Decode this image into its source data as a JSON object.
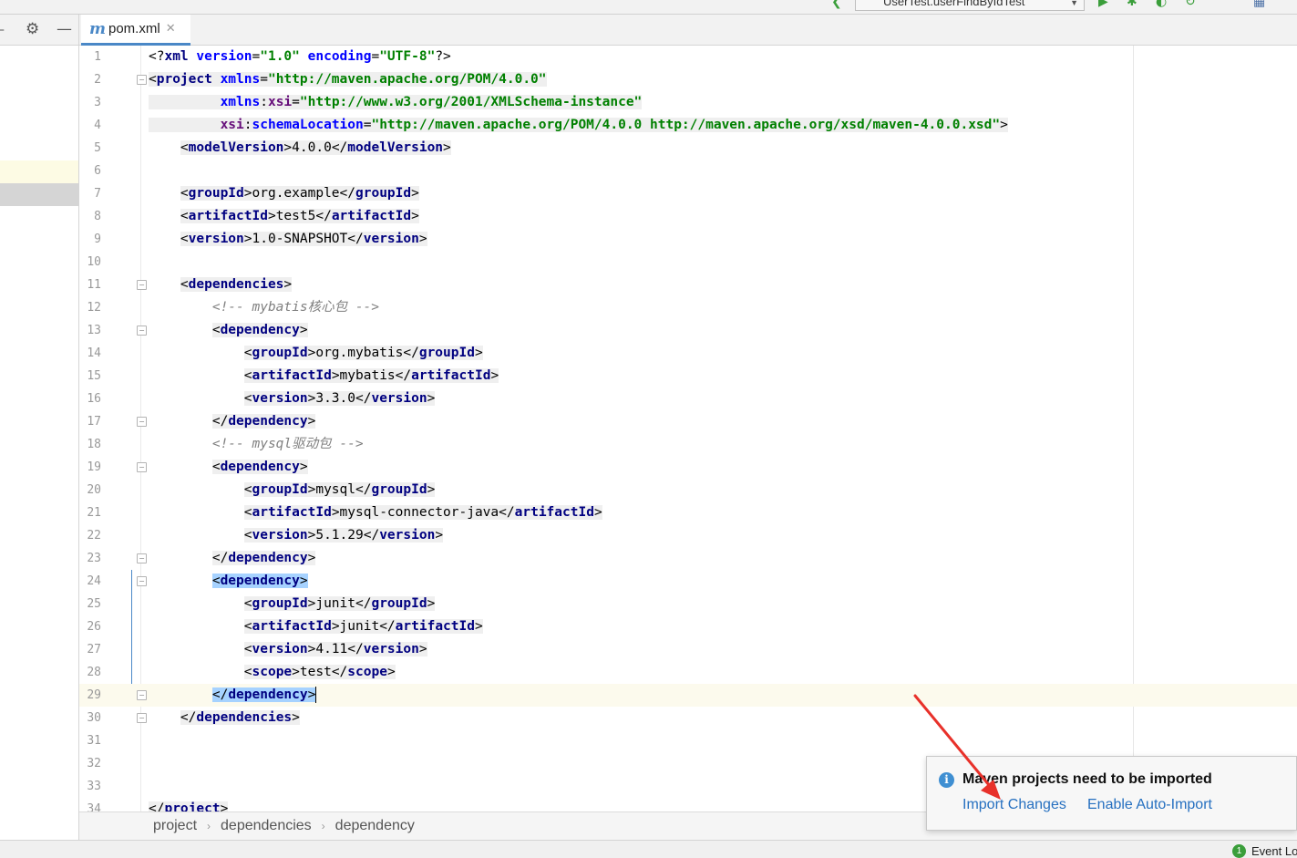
{
  "toolbar": {
    "run_config": "UserTest.userFindByIdTest"
  },
  "tab": {
    "label": "pom.xml",
    "icon": "m"
  },
  "editor": {
    "line_numbers": [
      "1",
      "2",
      "3",
      "4",
      "5",
      "6",
      "7",
      "8",
      "9",
      "10",
      "11",
      "12",
      "13",
      "14",
      "15",
      "16",
      "17",
      "18",
      "19",
      "20",
      "21",
      "22",
      "23",
      "24",
      "25",
      "26",
      "27",
      "28",
      "29",
      "30",
      "31",
      "32",
      "33",
      "34"
    ],
    "lines": {
      "l1": [
        "<?",
        "xml ",
        "version",
        "=",
        "\"1.0\" ",
        "encoding",
        "=",
        "\"UTF-8\"",
        "?>"
      ],
      "l2": [
        "<",
        "project ",
        "xmlns",
        "=",
        "\"http://maven.apache.org/POM/4.0.0\""
      ],
      "l3": [
        "xmlns",
        ":",
        "xsi",
        "=",
        "\"http://www.w3.org/2001/XMLSchema-instance\""
      ],
      "l4": [
        "xsi",
        ":",
        "schemaLocation",
        "=",
        "\"http://maven.apache.org/POM/4.0.0 http://maven.apache.org/xsd/maven-4.0.0.xsd\"",
        ">"
      ],
      "l5": [
        "modelVersion",
        "4.0.0"
      ],
      "l7": [
        "groupId",
        "org.example"
      ],
      "l8": [
        "artifactId",
        "test5"
      ],
      "l9": [
        "version",
        "1.0-SNAPSHOT"
      ],
      "l11": "dependencies",
      "l12": "<!-- mybatis核心包 -->",
      "l13": "dependency",
      "l14": [
        "groupId",
        "org.mybatis"
      ],
      "l15": [
        "artifactId",
        "mybatis"
      ],
      "l16": [
        "version",
        "3.3.0"
      ],
      "l17": "dependency",
      "l18": "<!-- mysql驱动包 -->",
      "l19": "dependency",
      "l20": [
        "groupId",
        "mysql"
      ],
      "l21": [
        "artifactId",
        "mysql-connector-java"
      ],
      "l22": [
        "version",
        "5.1.29"
      ],
      "l23": "dependency",
      "l24": "dependency",
      "l25": [
        "groupId",
        "junit"
      ],
      "l26": [
        "artifactId",
        "junit"
      ],
      "l27": [
        "version",
        "4.11"
      ],
      "l28": [
        "scope",
        "test"
      ],
      "l29": "dependency",
      "l30": "dependencies",
      "l34": "project"
    }
  },
  "breadcrumb": [
    "project",
    "dependencies",
    "dependency"
  ],
  "notification": {
    "title": "Maven projects need to be imported",
    "import_changes": "Import Changes",
    "enable_auto_import": "Enable Auto-Import"
  },
  "status": {
    "event_log": "Event Log",
    "event_count": "1"
  },
  "colors": {
    "tag": "#000080",
    "attribute": "#0000ff",
    "string": "#008000",
    "namespace": "#660e7a",
    "comment": "#808080",
    "selection": "#a6d2ff",
    "link": "#2670c0",
    "accent": "#4a88c7",
    "arrow": "#e8312a"
  }
}
